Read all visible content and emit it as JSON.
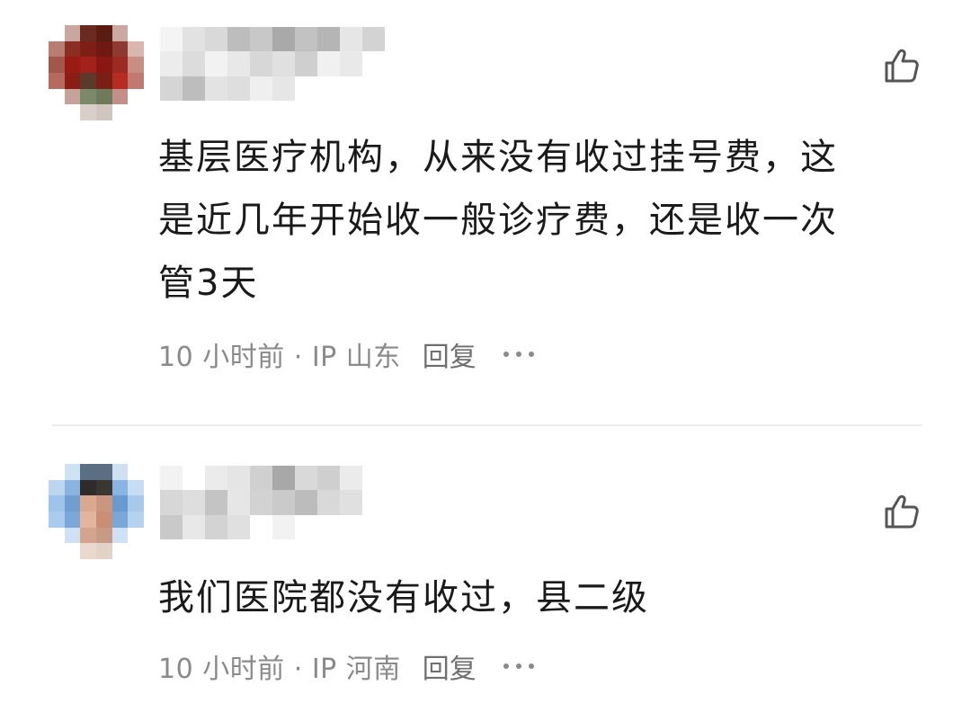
{
  "comments": [
    {
      "text_lines": [
        "基层医疗机构，从来没有收过挂号费，这",
        "是近几年开始收一般诊疗费，还是收一次",
        "管3天"
      ],
      "time": "10 小时前 · IP 山东",
      "reply_label": "回复",
      "like_icon": "thumbs-up-icon",
      "more_icon": "more-dots-icon",
      "avatar": "blurred-avatar"
    },
    {
      "text_lines": [
        "我们医院都没有收过，县二级"
      ],
      "time": "10 小时前 · IP 河南",
      "reply_label": "回复",
      "like_icon": "thumbs-up-icon",
      "more_icon": "more-dots-icon",
      "avatar": "blurred-avatar"
    }
  ],
  "colors": {
    "text_primary": "#1a1a1a",
    "text_secondary": "#8a8a8a",
    "divider": "#ececec",
    "background": "#ffffff"
  }
}
